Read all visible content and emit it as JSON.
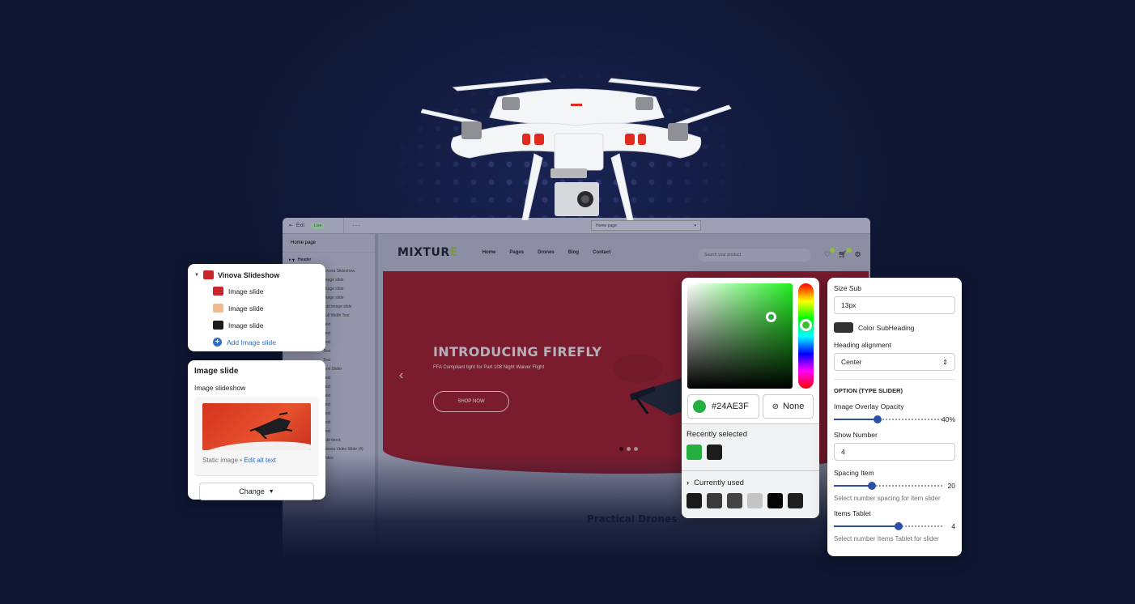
{
  "editor": {
    "topbar": {
      "exit_label": "Exit",
      "status_badge": "Live",
      "more_label": "···",
      "page_select": "Home page"
    },
    "sidebar": {
      "page_title": "Home page",
      "header_label": "Header",
      "rows": [
        "Vinova Slideshow",
        "Image slide",
        "Image slide",
        "Image slide",
        "Add image slide",
        "Full Width Text",
        "Text",
        "Text",
        "Text",
        "Text",
        "Text",
        "Text Slider",
        "Text",
        "Text",
        "Text",
        "Text",
        "Text",
        "Text",
        "Text",
        "Add block",
        "Vinova Video Wide (4)",
        "Video"
      ]
    },
    "site": {
      "logo": "MIXTUR",
      "logo_accent": "E",
      "menu": [
        "Home",
        "Pages",
        "Drones",
        "Blog",
        "Contact"
      ],
      "search_placeholder": "Search your product",
      "wishlist_count": "0",
      "cart_count": "0",
      "hero": {
        "heading": "INTRODUCING FIREFLY",
        "subheading": "FFA Compliant light for Part 108 Night Waiver Flight",
        "cta": "SHOP NOW",
        "prev_arrow": "‹",
        "slide_count": 3,
        "active_slide": 1
      },
      "next_section_title": "Practical Drones"
    }
  },
  "slideshow_panel": {
    "title": "Vinova Slideshow",
    "items": [
      {
        "label": "Image slide",
        "thumb_color": "#c8262a"
      },
      {
        "label": "Image slide",
        "thumb_color": "#f2b98a"
      },
      {
        "label": "Image slide",
        "thumb_color": "#1c1c1c"
      }
    ],
    "add_label": "Add Image slide"
  },
  "image_slide_panel": {
    "title": "Image slide",
    "field_label": "Image slideshow",
    "image_type": "Static image",
    "separator": "•",
    "edit_alt_link": "Edit alt text",
    "change_button": "Change"
  },
  "color_picker": {
    "hex_value": "#24AE3F",
    "selected_color": "#24AE3F",
    "none_label": "None",
    "recently_selected_label": "Recently selected",
    "recently_selected": [
      "#24AE3F",
      "#1c1c1c"
    ],
    "currently_used_label": "Currently used",
    "currently_used": [
      "#1a1a1a",
      "#3a3a3a",
      "#444444",
      "#c4c4c4",
      "#050505",
      "#1f1f1f"
    ]
  },
  "settings_panel": {
    "size_sub_label": "Size Sub",
    "size_sub_value": "13px",
    "color_subheading_label": "Color SubHeading",
    "color_subheading_swatch": "#333333",
    "heading_alignment_label": "Heading alignment",
    "heading_alignment_value": "Center",
    "section_title": "OPTION (TYPE SLIDER)",
    "overlay_opacity_label": "Image Overlay Opacity",
    "overlay_opacity_value": "40%",
    "overlay_opacity_fraction": 0.4,
    "show_number_label": "Show Number",
    "show_number_value": "4",
    "spacing_item_label": "Spacing Item",
    "spacing_item_value": "20",
    "spacing_item_fraction": 0.35,
    "spacing_item_help": "Select number spacing for item slider",
    "items_tablet_label": "Items Tablet",
    "items_tablet_value": "4",
    "items_tablet_fraction": 0.6,
    "items_tablet_help": "Select number Items Tablet for slider",
    "accent_color": "#2C4FA8"
  }
}
